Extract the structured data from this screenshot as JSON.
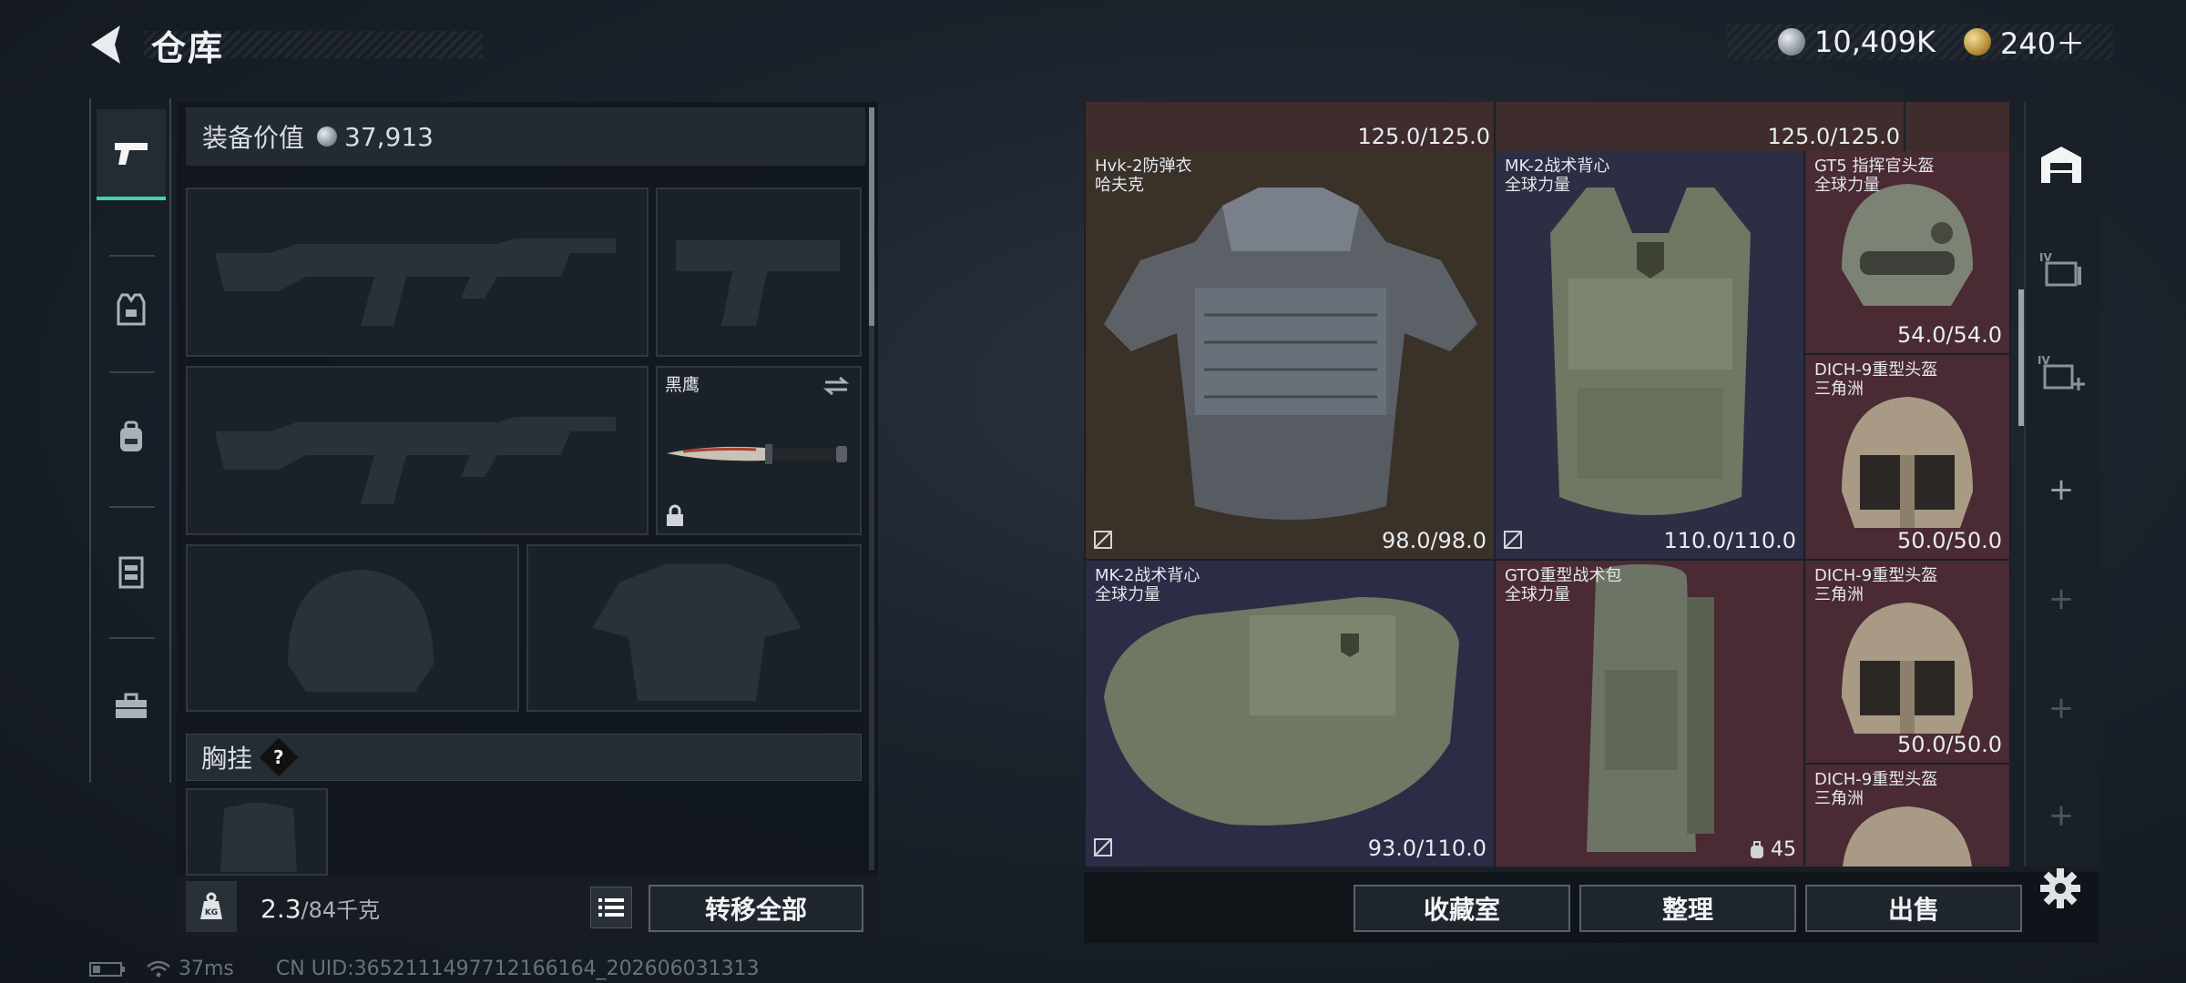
{
  "header": {
    "title": "仓库",
    "currency_silver": "10,409K",
    "currency_gold": "240＋"
  },
  "loadout": {
    "value_label": "装备价值",
    "value": "37,913",
    "melee_name": "黑鹰",
    "chest_rig_label": "胸挂",
    "chest_rig_help": "?",
    "weight_current": "2.3",
    "weight_max": "/84千克",
    "weight_badge": "KG",
    "transfer_all_label": "转移全部"
  },
  "storage": {
    "top_row_durability_1": "125.0/125.0",
    "top_row_durability_2": "125.0/125.0",
    "items": [
      {
        "name": "Hvk-2防弹衣",
        "sub": "哈夫克",
        "durability": "98.0/98.0"
      },
      {
        "name": "MK-2战术背心",
        "sub": "全球力量",
        "durability": "110.0/110.0"
      },
      {
        "name": "GT5 指挥官头盔",
        "sub": "全球力量",
        "durability": "54.0/54.0"
      },
      {
        "name": "DICH-9重型头盔",
        "sub": "三角洲",
        "durability": "50.0/50.0"
      },
      {
        "name": "MK-2战术背心",
        "sub": "全球力量",
        "durability": "93.0/110.0"
      },
      {
        "name": "GTO重型战术包",
        "sub": "全球力量",
        "count": "45"
      },
      {
        "name": "DICH-9重型头盔",
        "sub": "三角洲",
        "durability": "50.0/50.0"
      },
      {
        "name": "DICH-9重型头盔",
        "sub": "三角洲",
        "durability": ""
      }
    ]
  },
  "bottom_buttons": {
    "collection": "收藏室",
    "organize": "整理",
    "sell": "出售"
  },
  "status": {
    "ping": "37ms",
    "uid": "CN UID:3652111497712166164_202606031313"
  },
  "colors": {
    "accent": "#3ed7a0",
    "cell_brown": "#3a3129",
    "cell_navy": "#2a2d45",
    "cell_red": "#4a2a33"
  }
}
